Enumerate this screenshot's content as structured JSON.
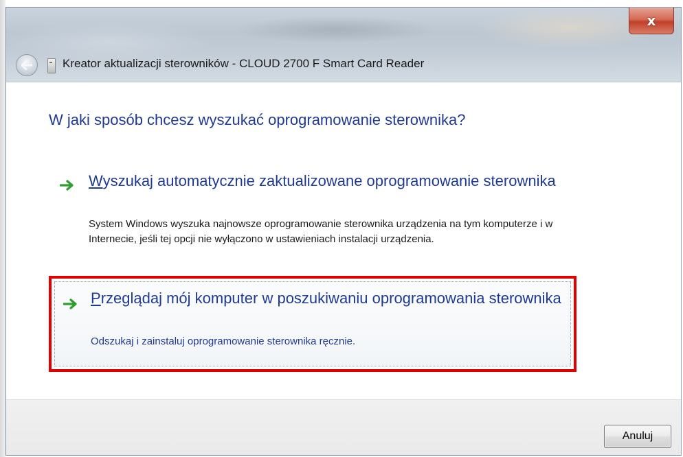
{
  "window": {
    "title": "Kreator aktualizacji sterowników - CLOUD 2700 F Smart Card Reader",
    "close_label": "x"
  },
  "icons": {
    "back": "back-arrow-icon",
    "device": "smart-card-reader-icon",
    "option_arrow": "green-arrow-icon",
    "close": "close-icon"
  },
  "content": {
    "heading": "W jaki sposób chcesz wyszukać oprogramowanie sterownika?",
    "options": [
      {
        "title_first": "W",
        "title_rest": "yszukaj automatycznie zaktualizowane oprogramowanie sterownika",
        "description": "System Windows wyszuka najnowsze oprogramowanie sterownika urządzenia na tym komputerze i w Internecie, jeśli tej opcji nie wyłączono w ustawieniach instalacji urządzenia.",
        "highlighted": false
      },
      {
        "title_first": "P",
        "title_rest": "rzeglądaj mój komputer w poszukiwaniu oprogramowania sterownika",
        "description": "Odszukaj i zainstaluj oprogramowanie sterownika ręcznie.",
        "highlighted": true
      }
    ]
  },
  "footer": {
    "cancel_label": "Anuluj"
  },
  "colors": {
    "link_blue": "#1f3a93",
    "highlight_red": "#e00000",
    "arrow_green": "#2e9e2e"
  }
}
